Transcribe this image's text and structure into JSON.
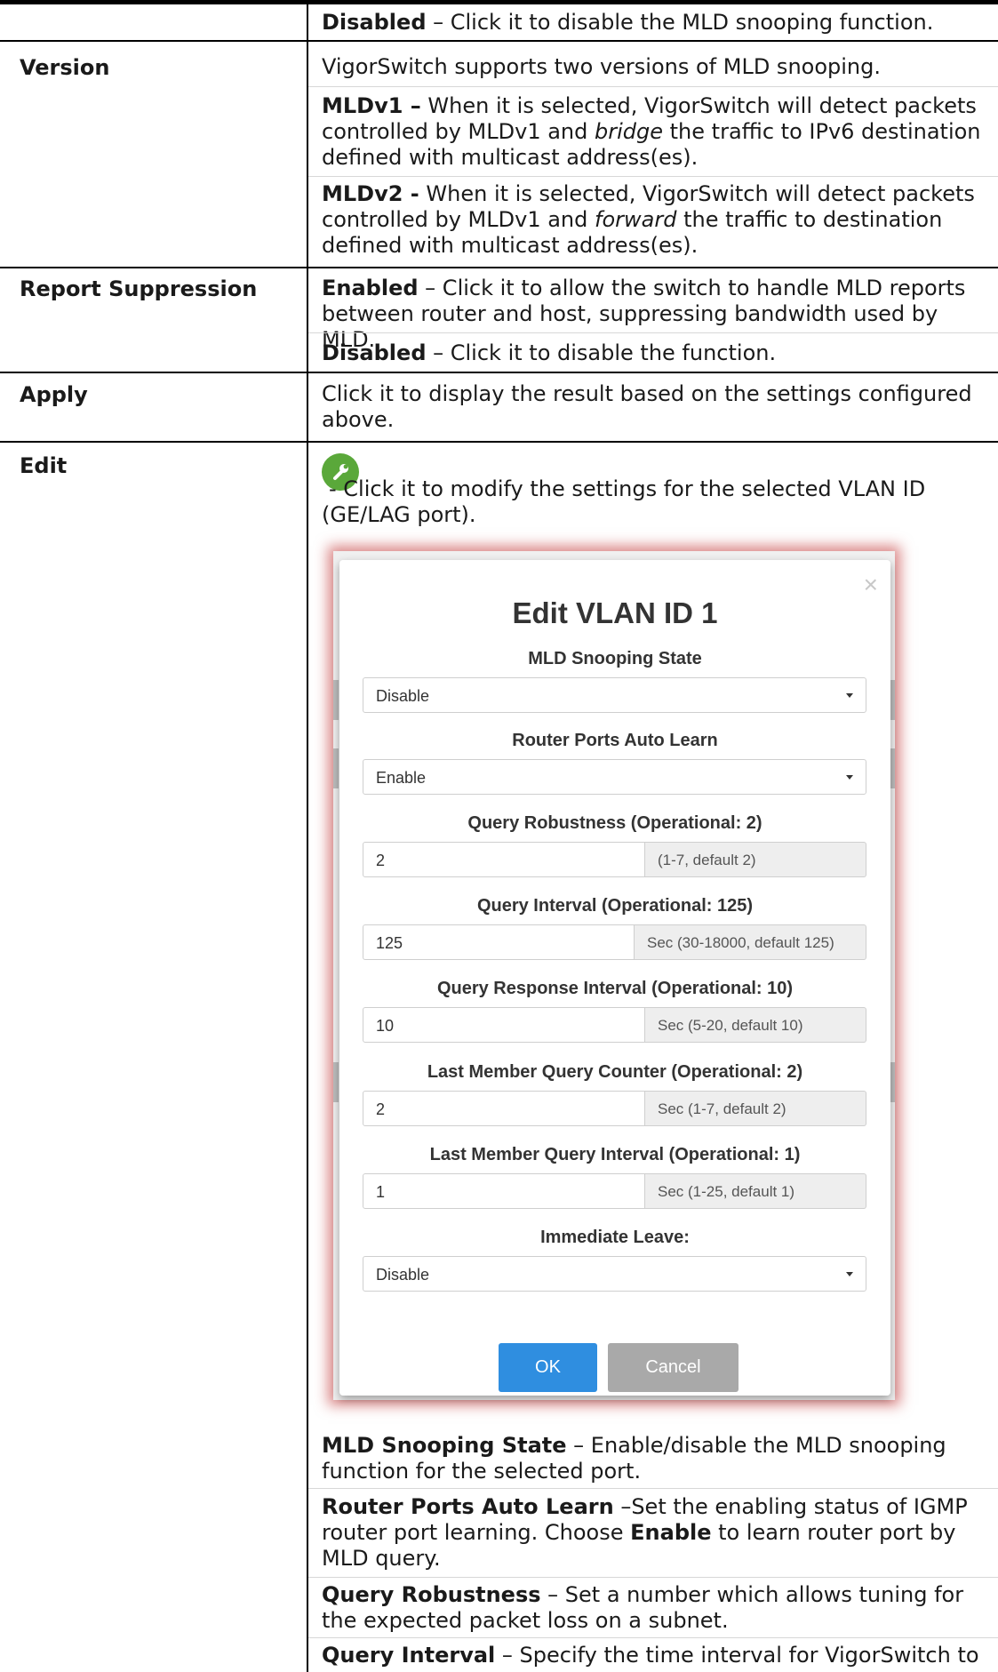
{
  "rows": {
    "disabled_top": {
      "term": "Disabled",
      "text": " – Click it to disable the MLD snooping function."
    },
    "version": {
      "label": "Version",
      "intro": "VigorSwitch supports two versions of MLD snooping.",
      "mldv1_term": "MLDv1 –",
      "mldv1_a": " When it is selected, VigorSwitch will detect packets controlled by MLDv1 and ",
      "mldv1_em": "bridge",
      "mldv1_b": " the traffic to IPv6 destination defined with multicast address(es).",
      "mldv2_term": "MLDv2 -",
      "mldv2_a": " When it is selected, VigorSwitch will detect packets controlled by MLDv1 and ",
      "mldv2_em": "forward",
      "mldv2_b": " the traffic to destination defined with multicast address(es)."
    },
    "report_suppression": {
      "label": "Report Suppression",
      "enabled_term": "Enabled",
      "enabled_text": " – Click it to allow the switch to handle MLD reports between router and host, suppressing bandwidth used by MLD.",
      "disabled_term": "Disabled",
      "disabled_text": " – Click it to disable the function."
    },
    "apply": {
      "label": "Apply",
      "text": "Click it to display the result based on the settings configured above."
    },
    "edit": {
      "label": "Edit",
      "icon": "wrench-icon",
      "icon_color": "#5aa83a",
      "text": "- Click it to modify the settings for the selected VLAN ID (GE/LAG port).",
      "desc_state_term": "MLD Snooping State",
      "desc_state_text": " – Enable/disable the MLD snooping function for the selected port.",
      "desc_router_term": "Router Ports Auto Learn",
      "desc_router_a": " –Set the enabling status of IGMP router port learning. Choose ",
      "desc_router_em": "Enable",
      "desc_router_b": " to learn router port by MLD query.",
      "desc_robust_term": "Query Robustness",
      "desc_robust_text": " – Set a number which allows tuning for the expected packet loss on a subnet.",
      "desc_interval_term": "Query Interval",
      "desc_interval_text": " – Specify the time interval for VigorSwitch to"
    }
  },
  "dialog": {
    "title": "Edit VLAN ID 1",
    "close_icon": "close-icon",
    "state_label": "MLD Snooping State",
    "state_value": "Disable",
    "autolearn_label": "Router Ports Auto Learn",
    "autolearn_value": "Enable",
    "robust_label": "Query Robustness (Operational: 2)",
    "robust_value": "2",
    "robust_hint": "(1-7, default 2)",
    "interval_label": "Query Interval (Operational: 125)",
    "interval_value": "125",
    "interval_hint": "Sec (30-18000, default 125)",
    "resp_label": "Query Response Interval (Operational: 10)",
    "resp_value": "10",
    "resp_hint": "Sec (5-20, default 10)",
    "lmqc_label": "Last Member Query Counter (Operational: 2)",
    "lmqc_value": "2",
    "lmqc_hint": "Sec (1-7, default 2)",
    "lmqi_label": "Last Member Query Interval (Operational: 1)",
    "lmqi_value": "1",
    "lmqi_hint": "Sec (1-25, default 1)",
    "leave_label": "Immediate Leave:",
    "leave_value": "Disable",
    "ok_label": "OK",
    "cancel_label": "Cancel",
    "ok_color": "#2f8ee0",
    "cancel_color": "#a9a9a9"
  }
}
